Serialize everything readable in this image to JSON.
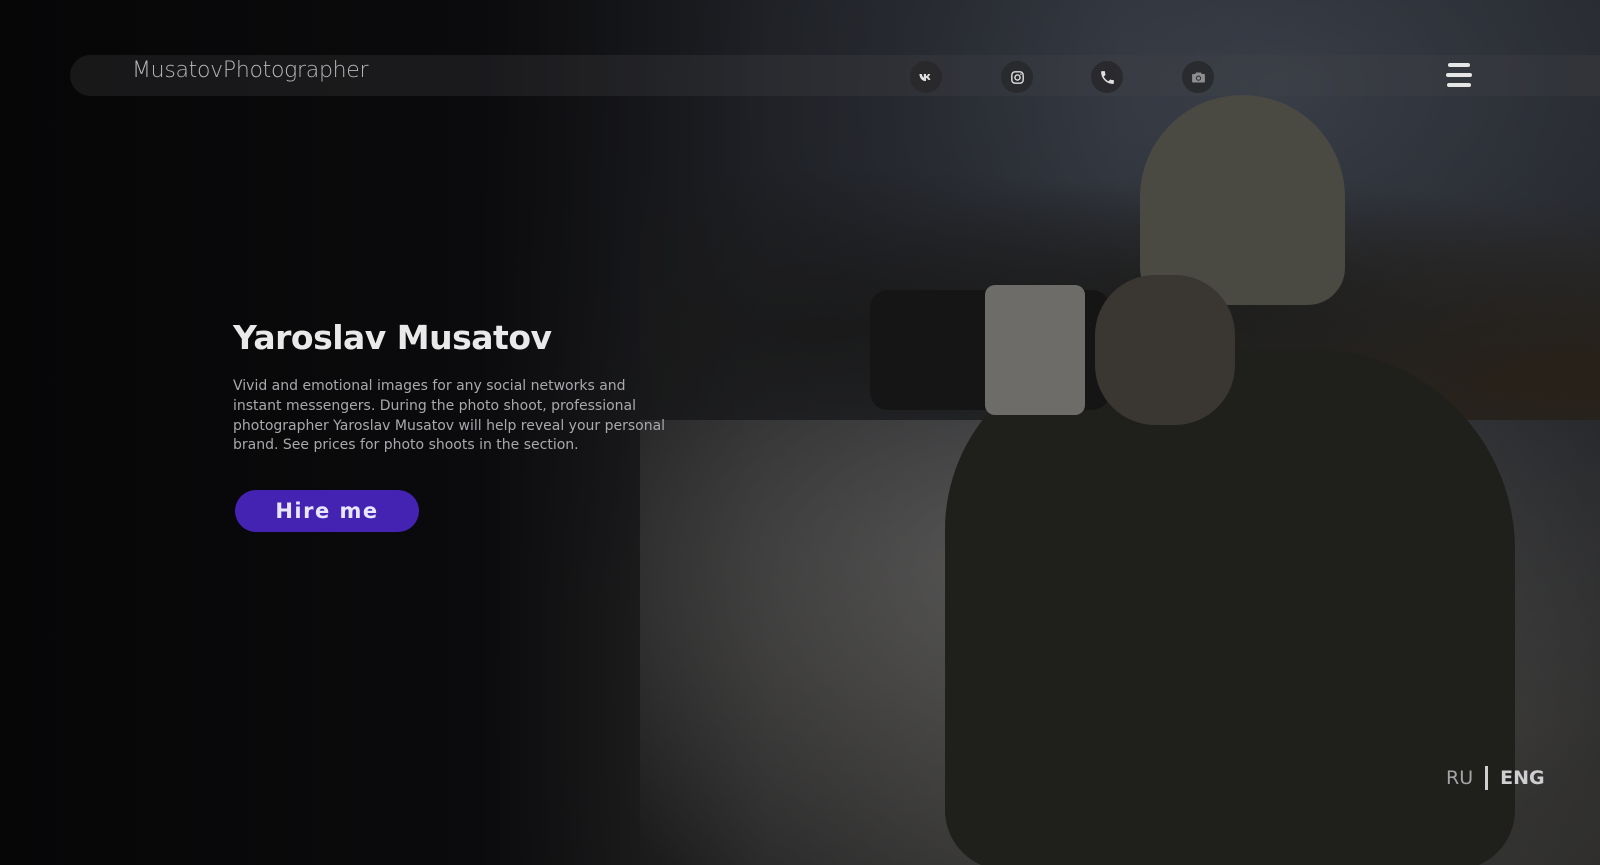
{
  "header": {
    "brand": "MusatovPhotographer",
    "social_icons": [
      {
        "name": "vk-icon"
      },
      {
        "name": "instagram-icon"
      },
      {
        "name": "phone-icon"
      },
      {
        "name": "camera-icon"
      }
    ],
    "menu_icon": "hamburger-menu-icon"
  },
  "hero": {
    "title": "Yaroslav Musatov",
    "description": "Vivid and emotional images for any social networks and instant messengers. During the photo shoot, professional photographer Yaroslav Musatov will help reveal your personal brand. See prices for photo shoots in the section.",
    "cta_label": "Hire me"
  },
  "language": {
    "ru": "RU",
    "eng": "ENG",
    "active": "ENG"
  },
  "colors": {
    "accent": "#4423b3",
    "background": "#0b0b0d",
    "text_primary": "#e9e9ea",
    "text_secondary": "#a9a9ad"
  }
}
